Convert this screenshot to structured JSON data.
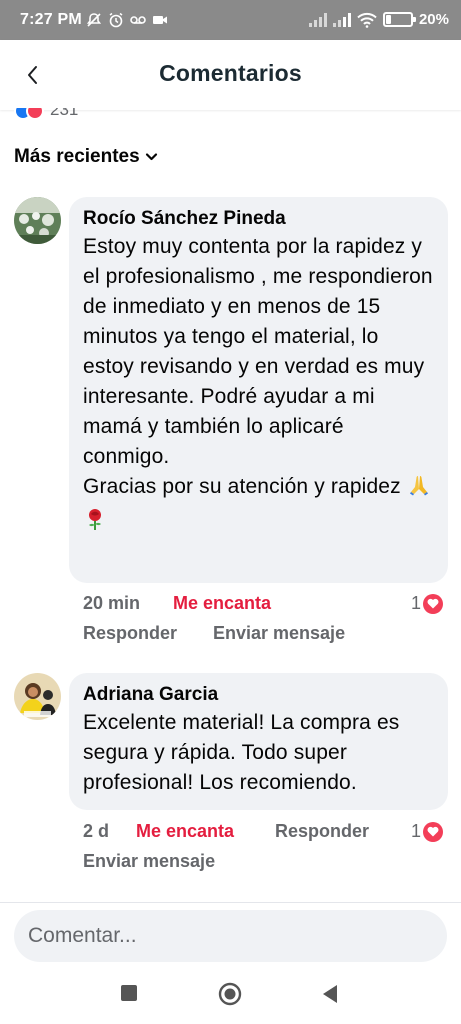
{
  "status_bar": {
    "time": "7:27 PM",
    "battery": "20%",
    "battery_level": 0.2,
    "icons_left": [
      "muted-notification-icon",
      "alarm-icon",
      "voicemail-icon",
      "video-icon"
    ],
    "icons_right": [
      "signal-icon",
      "signal-icon",
      "wifi-icon",
      "battery-icon"
    ]
  },
  "header": {
    "title": "Comentarios",
    "back_icon": "chevron-left-icon"
  },
  "reactions_peek": {
    "count": "231"
  },
  "sort": {
    "label": "Más recientes",
    "icon": "chevron-down-icon"
  },
  "comments": [
    {
      "author": "Rocío Sánchez Pineda",
      "text": "Estoy muy contenta por la rapidez y el profesionalismo , me respondieron de inmediato y en menos de 15 minutos ya tengo el material, lo estoy revisando y en verdad es muy interesante. Podré ayudar a mi mamá y también lo aplicaré conmigo.\nGracias por su atención y rapidez",
      "emojis": [
        "praying-hands-emoji",
        "rose-emoji"
      ],
      "time": "20 min",
      "reaction_label": "Me encanta",
      "reply_label": "Responder",
      "message_label": "Enviar mensaje",
      "reaction_count": "1"
    },
    {
      "author": "Adriana Garcia",
      "text": "Excelente material! La compra es segura y rápida. Todo super profesional! Los recomiendo.",
      "time": "2 d",
      "reaction_label": "Me encanta",
      "reply_label": "Responder",
      "message_label": "Enviar mensaje",
      "reaction_count": "1"
    }
  ],
  "composer": {
    "placeholder": "Comentar..."
  },
  "colors": {
    "accent_love": "#e41e3f",
    "bubble_bg": "#f0f2f5",
    "secondary_text": "#65676b",
    "status_bar_bg": "#8a8a8a"
  },
  "nav": {
    "buttons": [
      "recents-square-icon",
      "home-circle-icon",
      "back-triangle-icon"
    ]
  }
}
